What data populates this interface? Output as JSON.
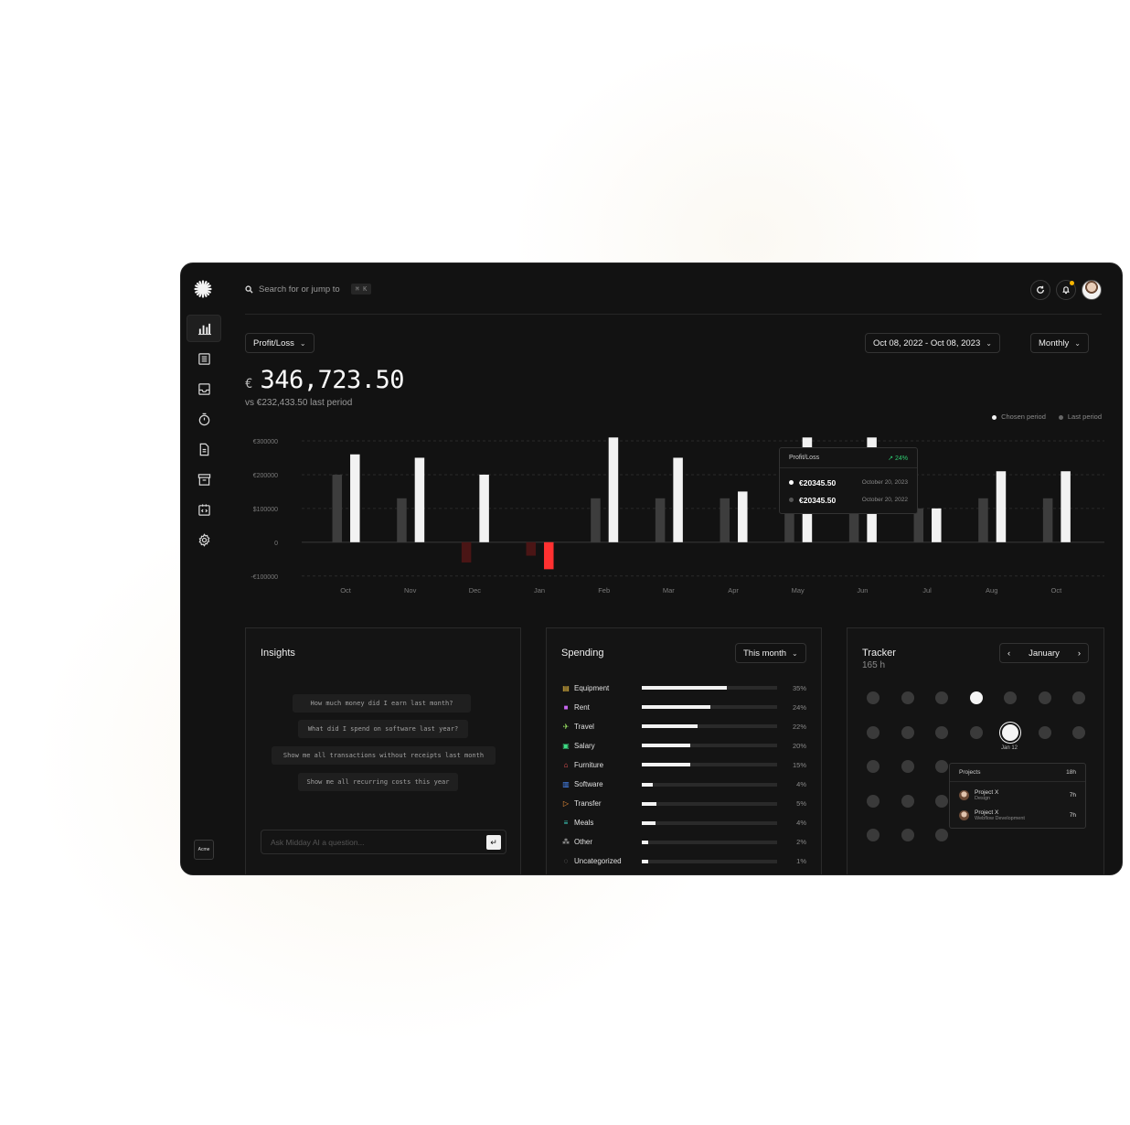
{
  "search": {
    "placeholder": "Search for or jump to",
    "shortcut": "⌘ K"
  },
  "header": {
    "report_select": "Profit/Loss",
    "date_range": "Oct 08, 2022 - Oct 08, 2023",
    "period": "Monthly",
    "currency": "€",
    "amount": "346,723.50",
    "compare": "vs €232,433.50 last period"
  },
  "sidebar": {
    "items": [
      "chart-icon",
      "list-icon",
      "inbox-icon",
      "timer-icon",
      "document-icon",
      "archive-icon",
      "code-icon",
      "gear-icon"
    ],
    "team": "Acme"
  },
  "legend": {
    "chosen": "Chosen period",
    "last": "Last period"
  },
  "chart_data": {
    "type": "bar",
    "categories": [
      "Oct",
      "Nov",
      "Dec",
      "Jan",
      "Feb",
      "Mar",
      "Apr",
      "May",
      "Jun",
      "Jul",
      "Aug",
      "Oct"
    ],
    "yticks": [
      "€300000",
      "€200000",
      "$100000",
      "0",
      "-€100000"
    ],
    "ylim": [
      -100000,
      300000
    ],
    "series": [
      {
        "name": "Last period",
        "color": "#3d3d3d",
        "negative_color": "#4a1515",
        "values": [
          200000,
          130000,
          -60000,
          -40000,
          130000,
          130000,
          130000,
          100000,
          130000,
          100000,
          130000,
          130000
        ]
      },
      {
        "name": "Chosen period",
        "color": "#f2f2f2",
        "negative_color": "#ff3131",
        "values": [
          260000,
          250000,
          200000,
          -80000,
          310000,
          250000,
          150000,
          310000,
          310000,
          100000,
          210000,
          210000
        ]
      }
    ],
    "tooltip": {
      "title": "Profit/Loss",
      "change": "24%",
      "rows": [
        {
          "value": "€20345.50",
          "date": "October 20, 2023",
          "color": "#ffffff"
        },
        {
          "value": "€20345.50",
          "date": "October 20, 2022",
          "color": "#555555"
        }
      ]
    }
  },
  "insights": {
    "title": "Insights",
    "suggestions": [
      "How much money did I earn last month?",
      "What did I spend on software last year?",
      "Show me all transactions without receipts last month",
      "Show me all recurring costs this year"
    ],
    "ask_placeholder": "Ask Midday AI a question..."
  },
  "spending": {
    "title": "Spending",
    "period": "This month",
    "items": [
      {
        "label": "Equipment",
        "pct": "35%",
        "fill": 0.63,
        "icon": "▤",
        "color": "#f5c542"
      },
      {
        "label": "Rent",
        "pct": "24%",
        "fill": 0.51,
        "icon": "■",
        "color": "#c767f0"
      },
      {
        "label": "Travel",
        "pct": "22%",
        "fill": 0.41,
        "icon": "✈",
        "color": "#9be564"
      },
      {
        "label": "Salary",
        "pct": "20%",
        "fill": 0.36,
        "icon": "▣",
        "color": "#3ddc84"
      },
      {
        "label": "Furniture",
        "pct": "15%",
        "fill": 0.36,
        "icon": "⌂",
        "color": "#ff5a5a"
      },
      {
        "label": "Software",
        "pct": "4%",
        "fill": 0.08,
        "icon": "▥",
        "color": "#4a8cff"
      },
      {
        "label": "Transfer",
        "pct": "5%",
        "fill": 0.11,
        "icon": "▷",
        "color": "#ff9a3d"
      },
      {
        "label": "Meals",
        "pct": "4%",
        "fill": 0.1,
        "icon": "≡",
        "color": "#3dd6c6"
      },
      {
        "label": "Other",
        "pct": "2%",
        "fill": 0.05,
        "icon": "⁂",
        "color": "#cccccc"
      },
      {
        "label": "Uncategorized",
        "pct": "1%",
        "fill": 0.05,
        "icon": "◌",
        "color": "#999999"
      }
    ]
  },
  "tracker": {
    "title": "Tracker",
    "hours": "165 h",
    "month": "January",
    "selected_label": "Jan 12",
    "popup": {
      "title": "Projects",
      "total": "18h",
      "rows": [
        {
          "name": "Project X",
          "sub": "Design",
          "hours": "7h"
        },
        {
          "name": "Project X",
          "sub": "Webflow Development",
          "hours": "7h"
        }
      ]
    }
  }
}
